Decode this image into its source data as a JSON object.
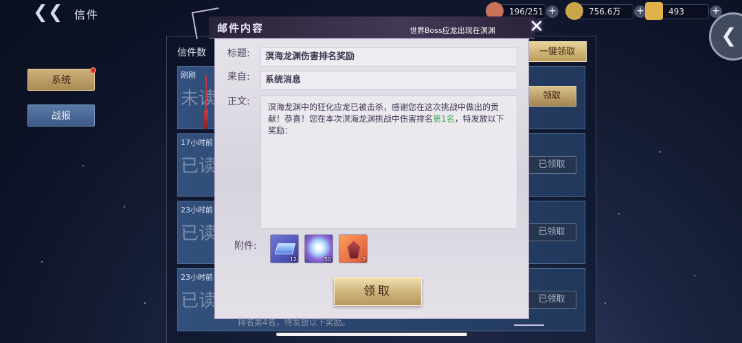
{
  "topbar": {
    "title": "信件",
    "resources": [
      {
        "name": "peach",
        "value": "196/251",
        "color": "#c9735a"
      },
      {
        "name": "coin",
        "value": "756.6万",
        "color": "#c9a64a"
      },
      {
        "name": "gold-ingot",
        "value": "493",
        "color": "#e0b24a"
      }
    ],
    "plus_label": "+"
  },
  "tabs": [
    {
      "label": "系统"
    },
    {
      "label": "战报"
    }
  ],
  "mail_list": {
    "count_label": "信件数",
    "claim_all_label": "一键领取",
    "items": [
      {
        "time": "刚刚",
        "status": "未读",
        "button": "领取"
      },
      {
        "time": "17小时前",
        "status": "已读",
        "button": "已领取"
      },
      {
        "time": "23小时前",
        "status": "已读",
        "button": "已领取"
      },
      {
        "time": "23小时前",
        "status": "已读",
        "button": "已领取"
      }
    ],
    "below_text": "排名第4名，特发放以下奖励。"
  },
  "dialog": {
    "title": "邮件内容",
    "ticker": "世界Boss应龙出现在溟渊",
    "subject_label": "标题:",
    "subject": "溟海龙渊伤害排名奖励",
    "from_label": "来自:",
    "from": "系统消息",
    "body_label": "正文:",
    "body_part1": "溟海龙渊中的狂化应龙已被击杀，感谢您在这次挑战中做出的贡献！恭喜！您在本次溟海龙渊挑战中伤害排名",
    "body_rank": "第1名",
    "body_part2": "，特发放以下奖励：",
    "attachments_label": "附件:",
    "attachments": [
      {
        "name": "blue-crystal-box",
        "count": "12"
      },
      {
        "name": "rainbow-orb",
        "count": "50"
      },
      {
        "name": "red-gem",
        "count": "2"
      }
    ],
    "claim_label": "领取"
  }
}
